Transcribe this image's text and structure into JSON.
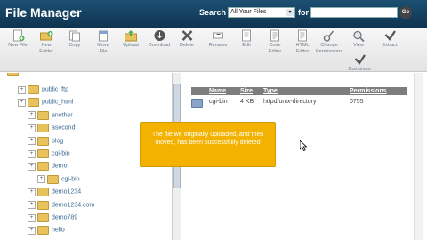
{
  "header": {
    "app_title": "File Manager",
    "search_label": "Search",
    "search_scope": "All Your Files",
    "for_label": "for",
    "search_value": "",
    "go_label": "Go"
  },
  "toolbar": [
    {
      "id": "new-file",
      "label_lines": [
        "New File"
      ],
      "icon": "new-file-icon"
    },
    {
      "id": "new-folder",
      "label_lines": [
        "New",
        "Folder"
      ],
      "icon": "new-folder-icon"
    },
    {
      "id": "copy",
      "label_lines": [
        "Copy"
      ],
      "icon": "copy-icon"
    },
    {
      "id": "move-file",
      "label_lines": [
        "Move",
        "File"
      ],
      "icon": "move-file-icon"
    },
    {
      "id": "upload",
      "label_lines": [
        "Upload"
      ],
      "icon": "upload-icon"
    },
    {
      "id": "download",
      "label_lines": [
        "Download"
      ],
      "icon": "download-icon"
    },
    {
      "id": "delete",
      "label_lines": [
        "Delete"
      ],
      "icon": "delete-icon"
    },
    {
      "id": "rename",
      "label_lines": [
        "Rename"
      ],
      "icon": "rename-icon"
    },
    {
      "id": "edit",
      "label_lines": [
        "Edit"
      ],
      "icon": "edit-icon"
    },
    {
      "id": "code-editor",
      "label_lines": [
        "Code",
        "Editor"
      ],
      "icon": "code-editor-icon"
    },
    {
      "id": "html-editor",
      "label_lines": [
        "HTML",
        "Editor"
      ],
      "icon": "html-editor-icon"
    },
    {
      "id": "change-permissions",
      "label_lines": [
        "Change",
        "Permissions"
      ],
      "icon": "permissions-icon"
    },
    {
      "id": "view",
      "label_lines": [
        "View"
      ],
      "icon": "view-icon"
    },
    {
      "id": "extract",
      "label_lines": [
        "Extract"
      ],
      "icon": "extract-icon"
    },
    {
      "id": "compress",
      "label_lines": [
        "Compress"
      ],
      "icon": "compress-icon"
    }
  ],
  "tree": [
    {
      "label": "public_ftp",
      "depth": 1
    },
    {
      "label": "public_html",
      "depth": 1
    },
    {
      "label": "another",
      "depth": 2
    },
    {
      "label": "asecond",
      "depth": 2
    },
    {
      "label": "blog",
      "depth": 2
    },
    {
      "label": "cgi-bin",
      "depth": 2
    },
    {
      "label": "demo",
      "depth": 2
    },
    {
      "label": "cgi-bin",
      "depth": 3
    },
    {
      "label": "demo1234",
      "depth": 2
    },
    {
      "label": "demo1234.com",
      "depth": 2
    },
    {
      "label": "demo789",
      "depth": 2
    },
    {
      "label": "hello",
      "depth": 2
    }
  ],
  "file_list": {
    "columns": [
      "Name",
      "Size",
      "Type",
      "Permissions"
    ],
    "rows": [
      {
        "name": "cgi-bin",
        "size": "4 KB",
        "type": "httpd/unix-directory",
        "permissions": "0755"
      }
    ]
  },
  "notification": {
    "message": "The file we originally uploaded, and then moved, has been successfully deleted"
  },
  "colors": {
    "titlebar": "#1c4f72",
    "notification_bg": "#f3b200",
    "list_header_bg": "#7d7d7d",
    "tree_text": "#3a6a94"
  }
}
